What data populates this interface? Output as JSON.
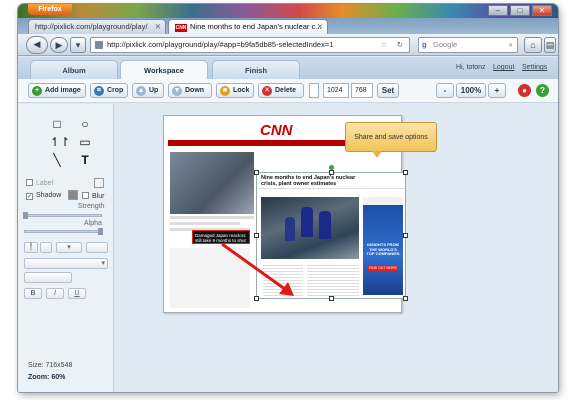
{
  "browser": {
    "app_button": "Firefox",
    "tabs": [
      {
        "label": "http://pixlick.com/playground/play/"
      },
      {
        "label": "Nine months to end Japan's nuclear c..."
      }
    ],
    "url": "http://pixlick.com/playground/play/#app=b9fa5db85-selectedIndex=1",
    "search_placeholder": "Google"
  },
  "app": {
    "tabs": [
      "Album",
      "Workspace",
      "Finish"
    ],
    "active_tab": "Workspace",
    "header_links": {
      "greeting": "Hi, totonz",
      "logout": "Logout",
      "settings": "Settings"
    },
    "toolbar": {
      "add_image": "Add image",
      "crop": "Crop",
      "up": "Up",
      "down": "Down",
      "lock": "Lock",
      "delete": "Delete",
      "width": "1024",
      "height": "768",
      "set": "Set",
      "zoom_out": "-",
      "zoom": "100%",
      "zoom_in": "+"
    },
    "left_panel": {
      "label_option": "Label",
      "shadow_option": "Shadow",
      "blur_option": "Blur",
      "strength_label": "Strength",
      "alpha_label": "Alpha",
      "size": "Size: 716x548",
      "zoom": "Zoom: 60%"
    },
    "canvas": {
      "share_tooltip": "Share and save options",
      "headline": "Nine months to end Japan's nuclear crisis, plant owner estimates",
      "callout": "Damaged Japan reactors still take 9 months to shut down",
      "ad_text": "INSIGHTS FROM THE WORLD'S TOP COMPANIES",
      "ad_button": "FIND OUT MORE",
      "logo": "CNN"
    },
    "colors": {
      "red_arrow": "#e01818",
      "accent_blue": "#2a66a8",
      "cnn_red": "#cc0000"
    }
  }
}
